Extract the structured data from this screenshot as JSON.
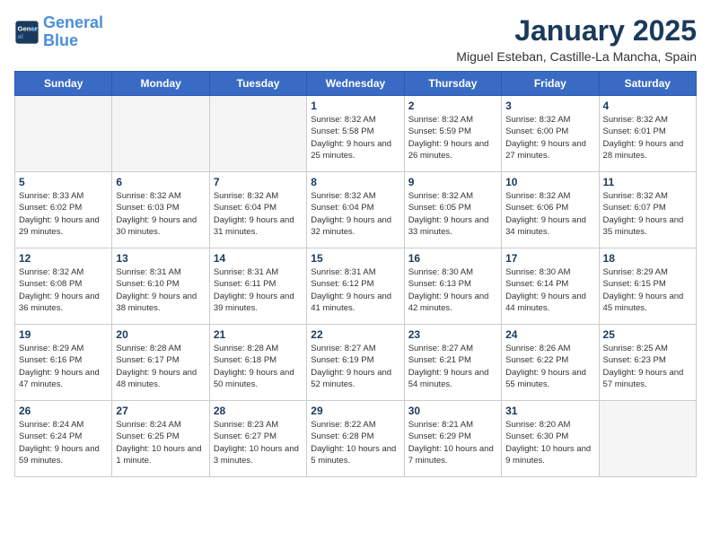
{
  "logo": {
    "line1": "General",
    "line2": "Blue"
  },
  "title": "January 2025",
  "location": "Miguel Esteban, Castille-La Mancha, Spain",
  "weekdays": [
    "Sunday",
    "Monday",
    "Tuesday",
    "Wednesday",
    "Thursday",
    "Friday",
    "Saturday"
  ],
  "weeks": [
    [
      {
        "day": "",
        "empty": true
      },
      {
        "day": "",
        "empty": true
      },
      {
        "day": "",
        "empty": true
      },
      {
        "day": "1",
        "sunrise": "8:32 AM",
        "sunset": "5:58 PM",
        "daylight": "9 hours and 25 minutes."
      },
      {
        "day": "2",
        "sunrise": "8:32 AM",
        "sunset": "5:59 PM",
        "daylight": "9 hours and 26 minutes."
      },
      {
        "day": "3",
        "sunrise": "8:32 AM",
        "sunset": "6:00 PM",
        "daylight": "9 hours and 27 minutes."
      },
      {
        "day": "4",
        "sunrise": "8:32 AM",
        "sunset": "6:01 PM",
        "daylight": "9 hours and 28 minutes."
      }
    ],
    [
      {
        "day": "5",
        "sunrise": "8:33 AM",
        "sunset": "6:02 PM",
        "daylight": "9 hours and 29 minutes."
      },
      {
        "day": "6",
        "sunrise": "8:32 AM",
        "sunset": "6:03 PM",
        "daylight": "9 hours and 30 minutes."
      },
      {
        "day": "7",
        "sunrise": "8:32 AM",
        "sunset": "6:04 PM",
        "daylight": "9 hours and 31 minutes."
      },
      {
        "day": "8",
        "sunrise": "8:32 AM",
        "sunset": "6:04 PM",
        "daylight": "9 hours and 32 minutes."
      },
      {
        "day": "9",
        "sunrise": "8:32 AM",
        "sunset": "6:05 PM",
        "daylight": "9 hours and 33 minutes."
      },
      {
        "day": "10",
        "sunrise": "8:32 AM",
        "sunset": "6:06 PM",
        "daylight": "9 hours and 34 minutes."
      },
      {
        "day": "11",
        "sunrise": "8:32 AM",
        "sunset": "6:07 PM",
        "daylight": "9 hours and 35 minutes."
      }
    ],
    [
      {
        "day": "12",
        "sunrise": "8:32 AM",
        "sunset": "6:08 PM",
        "daylight": "9 hours and 36 minutes."
      },
      {
        "day": "13",
        "sunrise": "8:31 AM",
        "sunset": "6:10 PM",
        "daylight": "9 hours and 38 minutes."
      },
      {
        "day": "14",
        "sunrise": "8:31 AM",
        "sunset": "6:11 PM",
        "daylight": "9 hours and 39 minutes."
      },
      {
        "day": "15",
        "sunrise": "8:31 AM",
        "sunset": "6:12 PM",
        "daylight": "9 hours and 41 minutes."
      },
      {
        "day": "16",
        "sunrise": "8:30 AM",
        "sunset": "6:13 PM",
        "daylight": "9 hours and 42 minutes."
      },
      {
        "day": "17",
        "sunrise": "8:30 AM",
        "sunset": "6:14 PM",
        "daylight": "9 hours and 44 minutes."
      },
      {
        "day": "18",
        "sunrise": "8:29 AM",
        "sunset": "6:15 PM",
        "daylight": "9 hours and 45 minutes."
      }
    ],
    [
      {
        "day": "19",
        "sunrise": "8:29 AM",
        "sunset": "6:16 PM",
        "daylight": "9 hours and 47 minutes."
      },
      {
        "day": "20",
        "sunrise": "8:28 AM",
        "sunset": "6:17 PM",
        "daylight": "9 hours and 48 minutes."
      },
      {
        "day": "21",
        "sunrise": "8:28 AM",
        "sunset": "6:18 PM",
        "daylight": "9 hours and 50 minutes."
      },
      {
        "day": "22",
        "sunrise": "8:27 AM",
        "sunset": "6:19 PM",
        "daylight": "9 hours and 52 minutes."
      },
      {
        "day": "23",
        "sunrise": "8:27 AM",
        "sunset": "6:21 PM",
        "daylight": "9 hours and 54 minutes."
      },
      {
        "day": "24",
        "sunrise": "8:26 AM",
        "sunset": "6:22 PM",
        "daylight": "9 hours and 55 minutes."
      },
      {
        "day": "25",
        "sunrise": "8:25 AM",
        "sunset": "6:23 PM",
        "daylight": "9 hours and 57 minutes."
      }
    ],
    [
      {
        "day": "26",
        "sunrise": "8:24 AM",
        "sunset": "6:24 PM",
        "daylight": "9 hours and 59 minutes."
      },
      {
        "day": "27",
        "sunrise": "8:24 AM",
        "sunset": "6:25 PM",
        "daylight": "10 hours and 1 minute."
      },
      {
        "day": "28",
        "sunrise": "8:23 AM",
        "sunset": "6:27 PM",
        "daylight": "10 hours and 3 minutes."
      },
      {
        "day": "29",
        "sunrise": "8:22 AM",
        "sunset": "6:28 PM",
        "daylight": "10 hours and 5 minutes."
      },
      {
        "day": "30",
        "sunrise": "8:21 AM",
        "sunset": "6:29 PM",
        "daylight": "10 hours and 7 minutes."
      },
      {
        "day": "31",
        "sunrise": "8:20 AM",
        "sunset": "6:30 PM",
        "daylight": "10 hours and 9 minutes."
      },
      {
        "day": "",
        "empty": true
      }
    ]
  ]
}
